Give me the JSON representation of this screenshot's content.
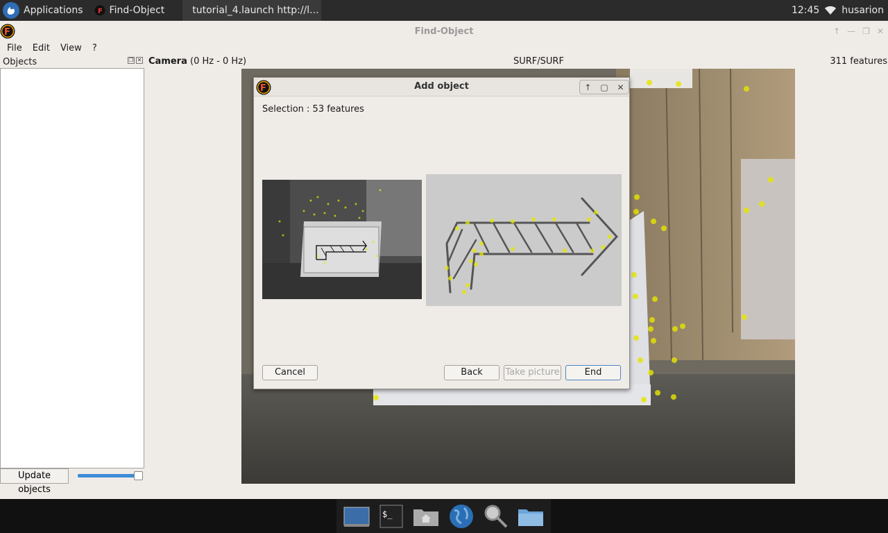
{
  "top_panel": {
    "applications": "Applications",
    "task1": "Find-Object",
    "task2": "tutorial_4.launch http://l...",
    "clock": "12:45",
    "user": "husarion"
  },
  "window": {
    "title": "Find-Object"
  },
  "menu": [
    "File",
    "Edit",
    "View",
    "?"
  ],
  "objects_panel": {
    "title": "Objects",
    "update_button": "Update objects",
    "slider_value": 1.0
  },
  "camera": {
    "label": "Camera",
    "rate": "(0 Hz - 0 Hz)",
    "algorithm": "SURF/SURF",
    "features": "311 features"
  },
  "dialog": {
    "title": "Add object",
    "selection": "Selection : 53 features",
    "cancel": "Cancel",
    "back": "Back",
    "take_picture": "Take picture",
    "end": "End"
  },
  "colors": {
    "panel_bg": "#2b2b2b",
    "window_bg": "#efebe7",
    "keypoint": "#e6e600",
    "accent": "#3d8bd8"
  }
}
